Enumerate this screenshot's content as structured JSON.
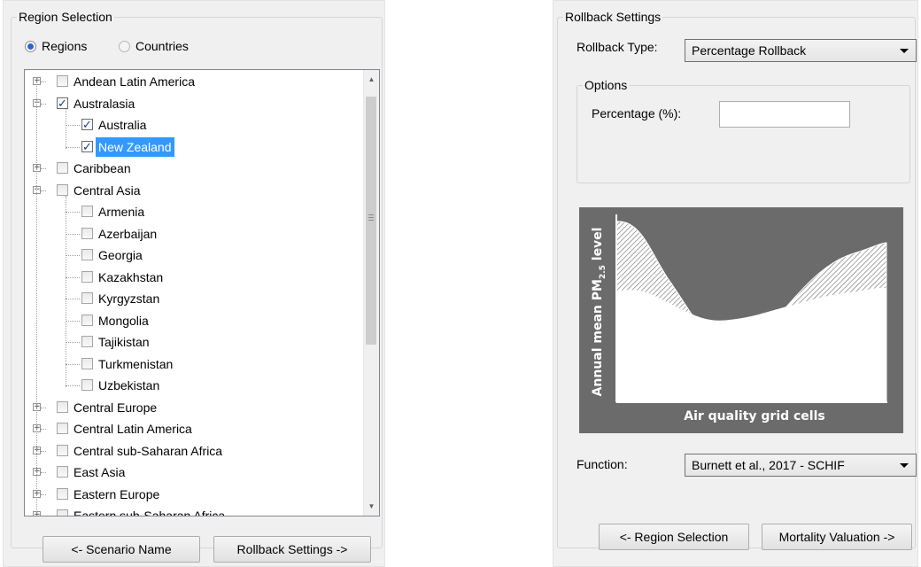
{
  "region_selection": {
    "title": "Region Selection",
    "radio_regions": "Regions",
    "radio_countries": "Countries",
    "selected_mode": "Regions",
    "tree": [
      {
        "label": "Andean Latin America",
        "level": 0,
        "expander": "+",
        "checked": false,
        "selected": false
      },
      {
        "label": "Australasia",
        "level": 0,
        "expander": "-",
        "checked": true,
        "selected": false
      },
      {
        "label": "Australia",
        "level": 1,
        "checked": true,
        "selected": false
      },
      {
        "label": "New Zealand",
        "level": 1,
        "checked": true,
        "selected": true
      },
      {
        "label": "Caribbean",
        "level": 0,
        "expander": "+",
        "checked": false,
        "selected": false
      },
      {
        "label": "Central Asia",
        "level": 0,
        "expander": "-",
        "checked": false,
        "selected": false
      },
      {
        "label": "Armenia",
        "level": 1,
        "checked": false,
        "selected": false
      },
      {
        "label": "Azerbaijan",
        "level": 1,
        "checked": false,
        "selected": false
      },
      {
        "label": "Georgia",
        "level": 1,
        "checked": false,
        "selected": false
      },
      {
        "label": "Kazakhstan",
        "level": 1,
        "checked": false,
        "selected": false
      },
      {
        "label": "Kyrgyzstan",
        "level": 1,
        "checked": false,
        "selected": false
      },
      {
        "label": "Mongolia",
        "level": 1,
        "checked": false,
        "selected": false
      },
      {
        "label": "Tajikistan",
        "level": 1,
        "checked": false,
        "selected": false
      },
      {
        "label": "Turkmenistan",
        "level": 1,
        "checked": false,
        "selected": false
      },
      {
        "label": "Uzbekistan",
        "level": 1,
        "checked": false,
        "selected": false
      },
      {
        "label": "Central Europe",
        "level": 0,
        "expander": "+",
        "checked": false,
        "selected": false
      },
      {
        "label": "Central Latin America",
        "level": 0,
        "expander": "+",
        "checked": false,
        "selected": false
      },
      {
        "label": "Central sub-Saharan Africa",
        "level": 0,
        "expander": "+",
        "checked": false,
        "selected": false
      },
      {
        "label": "East Asia",
        "level": 0,
        "expander": "+",
        "checked": false,
        "selected": false
      },
      {
        "label": "Eastern Europe",
        "level": 0,
        "expander": "+",
        "checked": false,
        "selected": false
      },
      {
        "label": "Eastern sub-Saharan Africa",
        "level": 0,
        "expander": "+",
        "checked": false,
        "selected": false
      }
    ],
    "back_button": "<- Scenario Name",
    "next_button": "Rollback Settings ->"
  },
  "rollback_settings": {
    "title": "Rollback Settings",
    "type_label": "Rollback Type:",
    "type_value": "Percentage Rollback",
    "options_title": "Options",
    "percentage_label": "Percentage (%):",
    "percentage_value": "",
    "figure": {
      "y_label_prefix": "Annual mean PM",
      "y_label_subscript": "2.5",
      "y_label_suffix": " level",
      "x_label": "Air quality grid cells"
    },
    "function_label": "Function:",
    "function_value": "Burnett et al., 2017 - SCHIF",
    "back_button": "<- Region Selection",
    "next_button": "Mortality Valuation ->"
  },
  "colors": {
    "selection": "#3399ff",
    "panel_bg": "#f0f0f0",
    "figure_bg": "#6b6b6b"
  }
}
